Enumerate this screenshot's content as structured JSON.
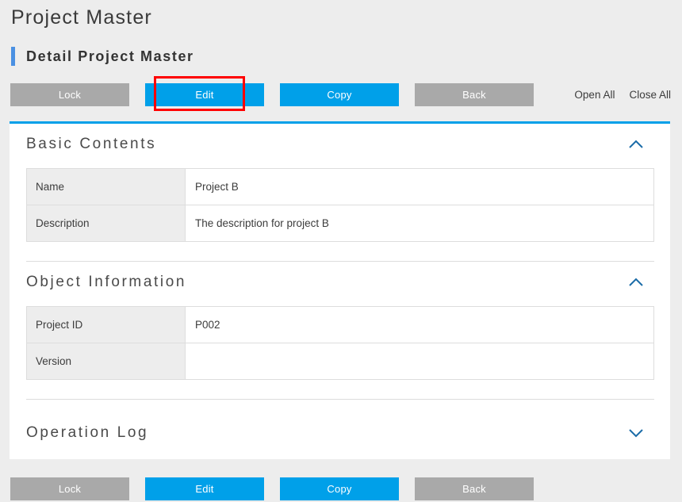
{
  "page": {
    "title": "Project Master",
    "sub_title": "Detail Project Master"
  },
  "toolbar": {
    "buttons": [
      {
        "label": "Lock",
        "style": "gray"
      },
      {
        "label": "Edit",
        "style": "blue"
      },
      {
        "label": "Copy",
        "style": "blue"
      },
      {
        "label": "Back",
        "style": "gray"
      }
    ],
    "links": [
      {
        "label": "Open All"
      },
      {
        "label": "Close All"
      }
    ]
  },
  "sections": [
    {
      "title": "Basic Contents",
      "expanded": true,
      "chevron": "chevron-up-icon",
      "rows": [
        {
          "label": "Name",
          "value": "Project B"
        },
        {
          "label": "Description",
          "value": "The description for project B"
        }
      ]
    },
    {
      "title": "Object Information",
      "expanded": true,
      "chevron": "chevron-up-icon",
      "rows": [
        {
          "label": "Project ID",
          "value": "P002"
        },
        {
          "label": "Version",
          "value": ""
        }
      ]
    },
    {
      "title": "Operation Log",
      "expanded": false,
      "chevron": "chevron-down-icon",
      "rows": []
    }
  ],
  "footer": {
    "buttons": [
      {
        "label": "Lock",
        "style": "gray"
      },
      {
        "label": "Edit",
        "style": "blue"
      },
      {
        "label": "Copy",
        "style": "blue"
      },
      {
        "label": "Back",
        "style": "gray"
      }
    ]
  },
  "annotation": {
    "target": "Edit",
    "color": "#FF0000"
  },
  "colors": {
    "accent_blue": "#00A0E9",
    "bar_blue": "#4A90E2",
    "button_gray": "#A9A9A9",
    "page_background": "#EDEDED",
    "card_background": "#FFFFFF",
    "label_cell_background": "#EDEDED",
    "border": "#DDDDDD"
  }
}
